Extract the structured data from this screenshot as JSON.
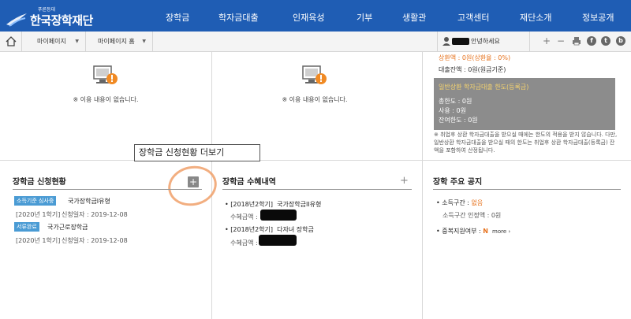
{
  "brand": {
    "sub": "푸른등대",
    "title": "한국장학재단",
    "color": "#1f5db4"
  },
  "nav": {
    "items": [
      "장학금",
      "학자금대출",
      "인재육성",
      "기부",
      "생활관",
      "고객센터",
      "재단소개",
      "정보공개"
    ]
  },
  "subbar": {
    "home_icon": "home-icon",
    "crumb1": "마이페이지",
    "crumb2": "마이페이지 홈",
    "greeting": "안녕하세요",
    "tools": [
      "+",
      "−"
    ],
    "social": [
      "f",
      "t",
      "b"
    ]
  },
  "empty": {
    "text": "※ 이용 내용이 없습니다."
  },
  "loan": {
    "repay_prefix": "상환액 : ",
    "repay_value": "0원(상환율 : 0%)",
    "balance": "대출잔액 : 0원(원금기준)",
    "card_title": "일반상환 학자금대출 한도(등록금)",
    "card_rows": [
      "총한도 : 0원",
      "사용 : 0원",
      "잔여한도 : 0원"
    ],
    "note": "※ 취업후 상환 학자금대출을 받으실 때에는 한도의 적용을 받지 않습니다. 다만, 일반상환 학자금대출을 받으실 때의 한도는 취업후 상환 학자금대출(등록금) 잔액을 포함하여 산정됩니다."
  },
  "tooltip": "장학금 신청현황 더보기",
  "apply": {
    "title": "장학금 신청현황",
    "items": [
      {
        "badge": "소득기준 심사중",
        "badge_color": "#4a9bd4",
        "name": "국가장학금I유형",
        "term": "[2020년 1학기]",
        "date": "신청일자 : 2019-12-08"
      },
      {
        "badge": "서류완료",
        "badge_color": "#4a9bd4",
        "name": "국가근로장학금",
        "term": "[2020년 1학기]",
        "date": "신청일자 : 2019-12-08"
      }
    ]
  },
  "benefit": {
    "title": "장학금 수혜내역",
    "items": [
      {
        "term": "[2018년2학기]",
        "name": "국가장학금II유형",
        "amount_label": "수혜금액 :"
      },
      {
        "term": "[2018년2학기]",
        "name": "다자녀 장학금",
        "amount_label": "수혜금액 :"
      }
    ]
  },
  "notice": {
    "title": "장학 주요 공지",
    "income_label": "소득구간 : ",
    "income_value": "없음",
    "income_recog": "소득구간 인정액 : 0원",
    "dup_label": "중복지원여부 : ",
    "dup_value": "N",
    "more": "more ›"
  }
}
